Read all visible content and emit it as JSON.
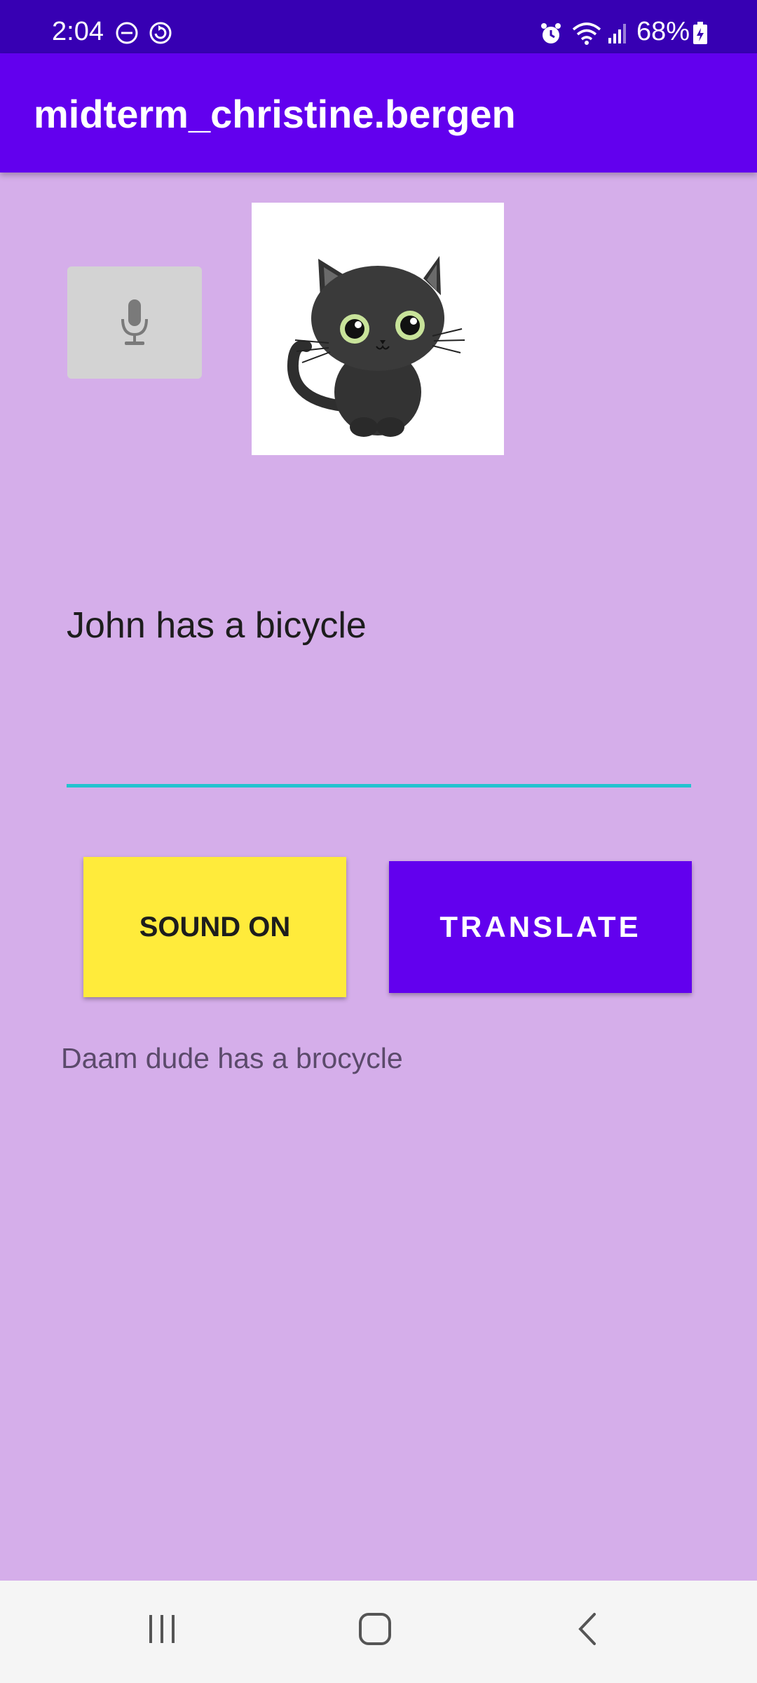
{
  "status_bar": {
    "time": "2:04",
    "battery": "68%",
    "icons": [
      "do-not-disturb-icon",
      "sync-icon",
      "alarm-icon",
      "wifi-icon",
      "signal-icon",
      "battery-icon"
    ]
  },
  "app_bar": {
    "title": "midterm_christine.bergen",
    "color": "#6200ee"
  },
  "mic_button": {
    "icon": "microphone-icon"
  },
  "cat_image": {
    "icon": "cat-image"
  },
  "input": {
    "value": "John has a bicycle",
    "underline_color": "#22c3cf"
  },
  "buttons": {
    "sound": {
      "label": "SOUND ON",
      "color": "#ffeb3b"
    },
    "translate": {
      "label": "TRANSLATE",
      "color": "#6200ee"
    }
  },
  "result": {
    "text": "Daam dude has a brocycle"
  },
  "nav_bar": {
    "icons": [
      "recent-apps-icon",
      "home-icon",
      "back-icon"
    ]
  },
  "background_color": "#d5aeea"
}
